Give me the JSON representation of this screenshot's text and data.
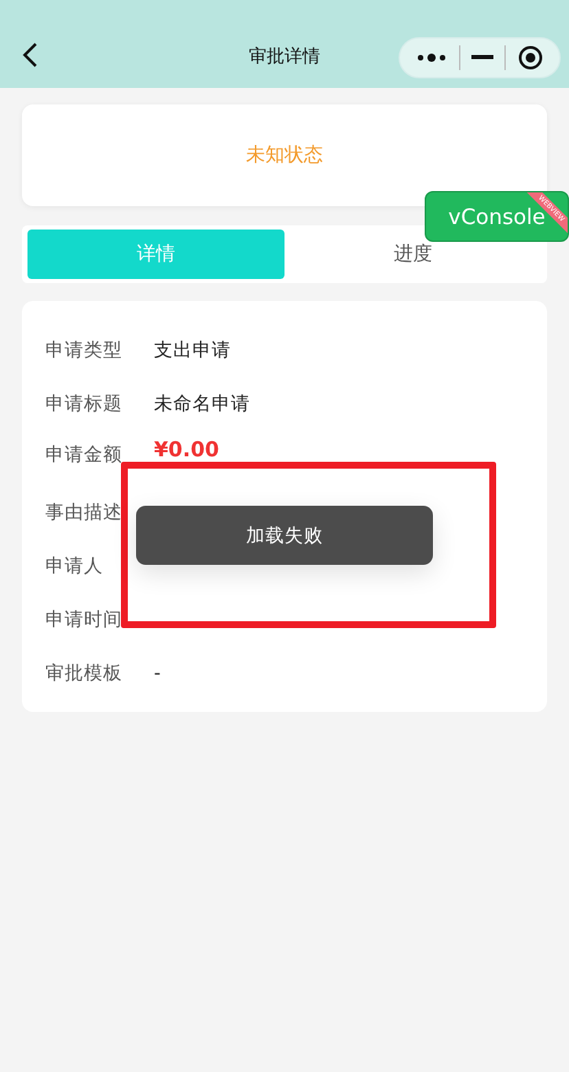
{
  "nav": {
    "title": "审批详情"
  },
  "status": {
    "text": "未知状态"
  },
  "tabs": [
    {
      "label": "详情",
      "selected": true
    },
    {
      "label": "进度",
      "selected": false
    }
  ],
  "details": [
    {
      "label": "申请类型",
      "value": "支出申请",
      "kind": "text"
    },
    {
      "label": "申请标题",
      "value": "未命名申请",
      "kind": "text"
    },
    {
      "label": "申请金额",
      "value": "¥0.00",
      "kind": "amount"
    },
    {
      "label": "事由描述",
      "kind": "text"
    },
    {
      "label": "申请人",
      "kind": "text"
    },
    {
      "label": "申请时间",
      "kind": "text"
    },
    {
      "label": "审批模板",
      "value": "-",
      "kind": "text"
    }
  ],
  "toast": {
    "text": "加载失败"
  },
  "vconsole": {
    "label": "vConsole",
    "ribbon": "WEBVIEW"
  }
}
